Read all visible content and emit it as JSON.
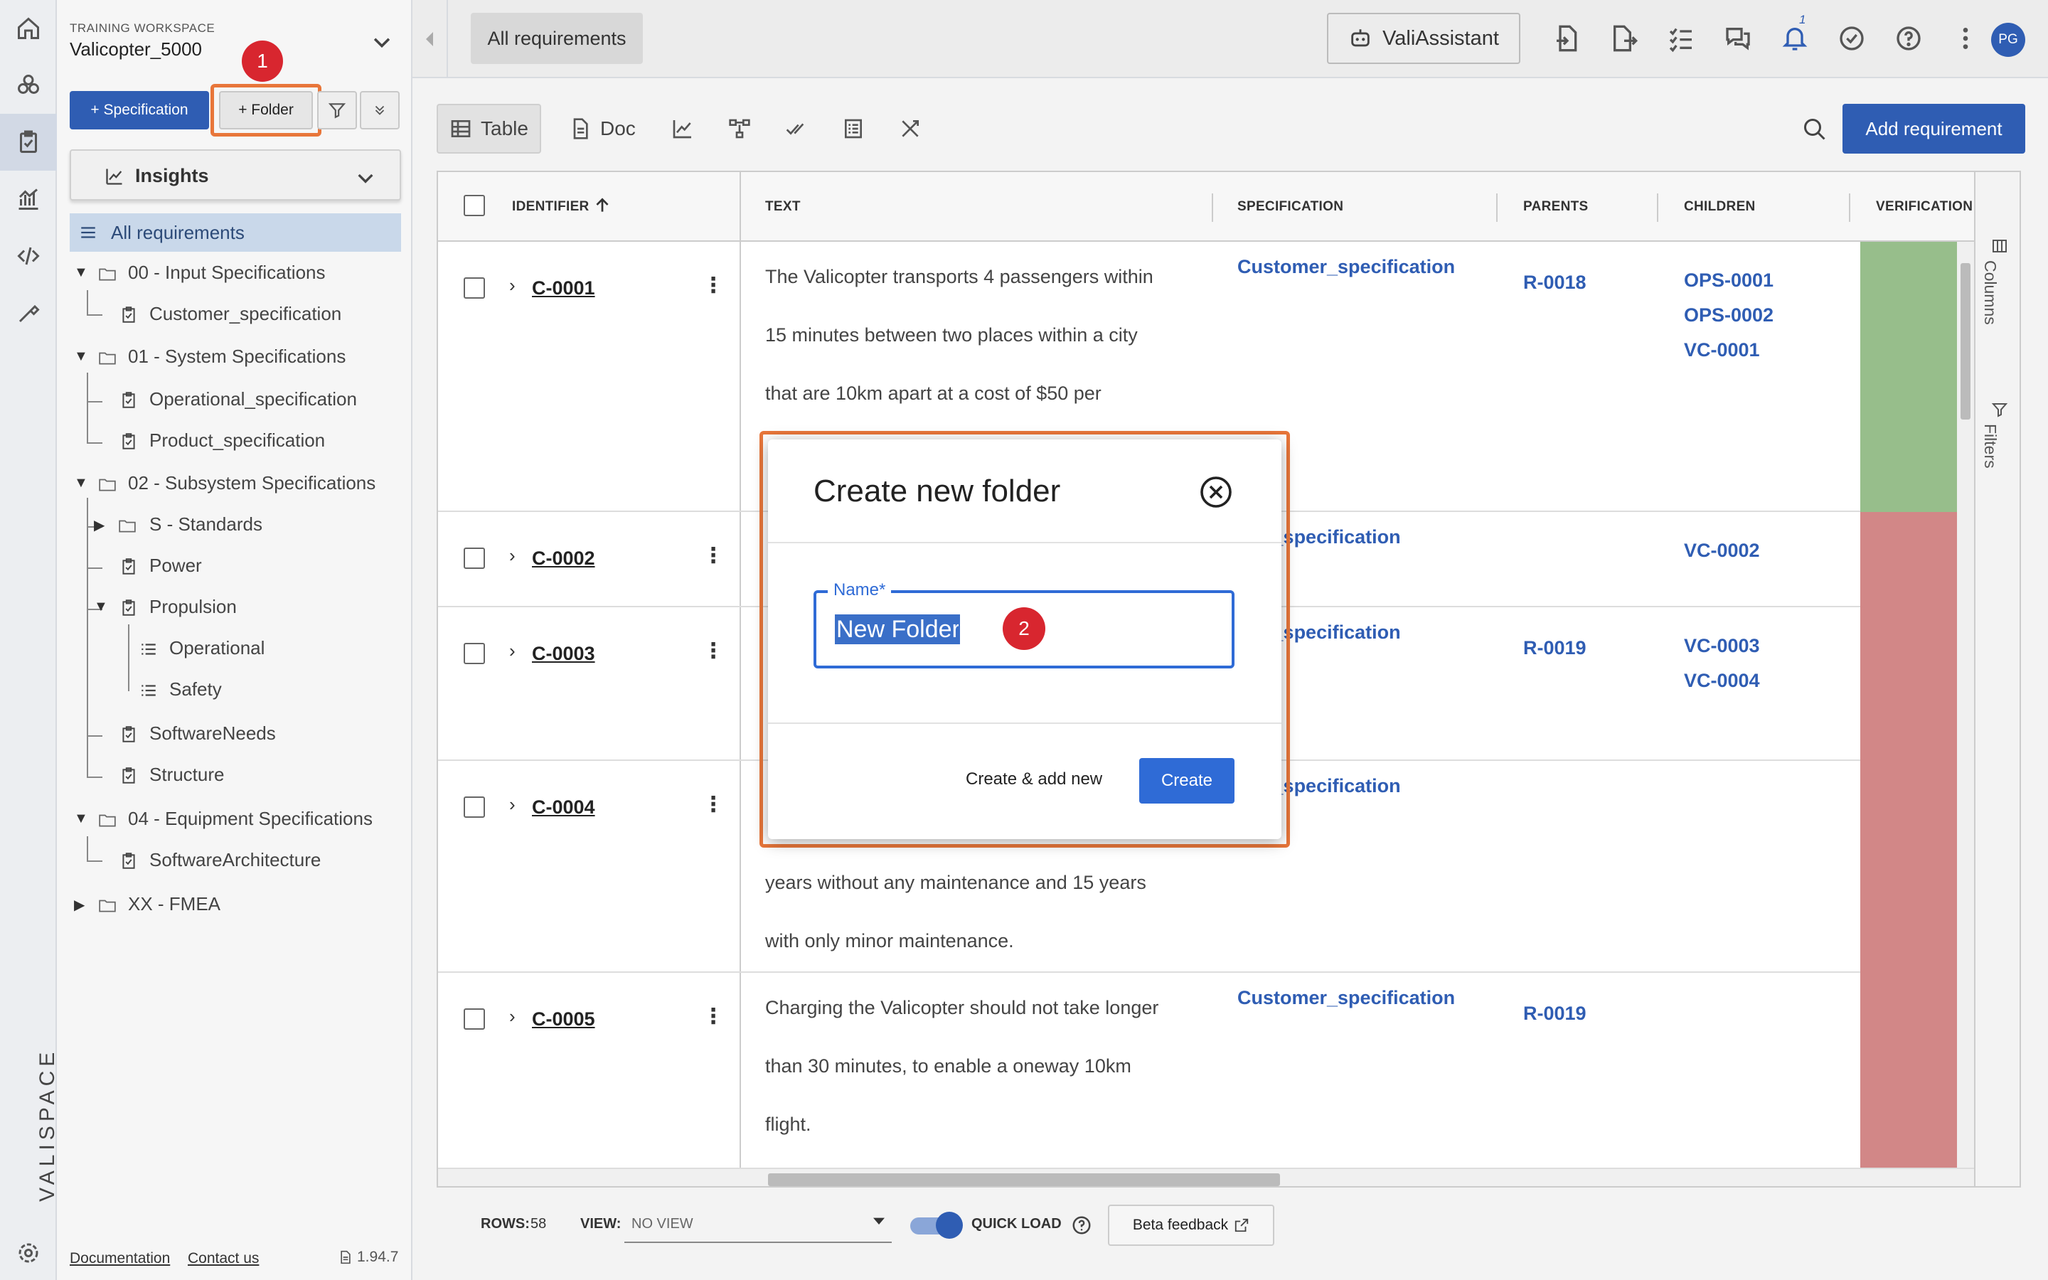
{
  "workspace": {
    "label": "TRAINING WORKSPACE",
    "name": "Valicopter_5000"
  },
  "sidebar": {
    "spec_button": "+ Specification",
    "folder_button": "+ Folder",
    "insights": "Insights",
    "all_requirements": "All requirements",
    "tree": [
      "00 - Input Specifications",
      "Customer_specification",
      "01 - System Specifications",
      "Operational_specification",
      "Product_specification",
      "02 - Subsystem Specifications",
      "S - Standards",
      "Power",
      "Propulsion",
      "Operational",
      "Safety",
      "SoftwareNeeds",
      "Structure",
      "04 - Equipment Specifications",
      "SoftwareArchitecture",
      "XX - FMEA"
    ],
    "footer": {
      "documentation": "Documentation",
      "contact": "Contact us",
      "version": "1.94.7"
    }
  },
  "badges": {
    "step1": "1",
    "step2": "2"
  },
  "header": {
    "tab": "All requirements",
    "assistant": "ValiAssistant",
    "notification_count": "1",
    "avatar": "PG"
  },
  "toolbar": {
    "views": [
      "Table",
      "Doc"
    ],
    "add_requirement": "Add requirement"
  },
  "table": {
    "columns": [
      "IDENTIFIER",
      "TEXT",
      "SPECIFICATION",
      "PARENTS",
      "CHILDREN",
      "VERIFICATION ST"
    ],
    "rows": [
      {
        "id": "C-0001",
        "text": [
          "The Valicopter transports 4 passengers within",
          "15 minutes between two places within a city",
          "that are 10km apart at a cost of $50 per"
        ],
        "spec": "Customer_specification",
        "parents": "R-0018",
        "children": [
          "OPS-0001",
          "OPS-0002",
          "VC-0001"
        ]
      },
      {
        "id": "C-0002",
        "text": [],
        "spec": "mer_specification",
        "parents": "",
        "children": [
          "VC-0002"
        ]
      },
      {
        "id": "C-0003",
        "text": [],
        "spec": "mer_specification",
        "parents": "R-0019",
        "children": [
          "VC-0003",
          "VC-0004"
        ]
      },
      {
        "id": "C-0004",
        "text": [
          "years without any maintenance and 15 years",
          "with only minor maintenance."
        ],
        "spec": "mer_specification",
        "parents": "",
        "children": []
      },
      {
        "id": "C-0005",
        "text": [
          "Charging the Valicopter should not take longer",
          "than 30 minutes, to enable a oneway 10km",
          "flight."
        ],
        "spec": "Customer_specification",
        "parents": "R-0019",
        "children": []
      }
    ],
    "side_columns": "Columns",
    "side_filters": "Filters",
    "colors": {
      "verified": "#97be8b",
      "failed": "#d28787"
    }
  },
  "footer": {
    "rows_label": "ROWS:",
    "rows_value": "58",
    "view_label": "VIEW:",
    "view_value": "NO VIEW",
    "quick_load": "QUICK LOAD",
    "beta_feedback": "Beta feedback"
  },
  "modal": {
    "title": "Create new folder",
    "name_label": "Name*",
    "name_value": "New Folder",
    "create_add_new": "Create & add new",
    "create": "Create"
  }
}
